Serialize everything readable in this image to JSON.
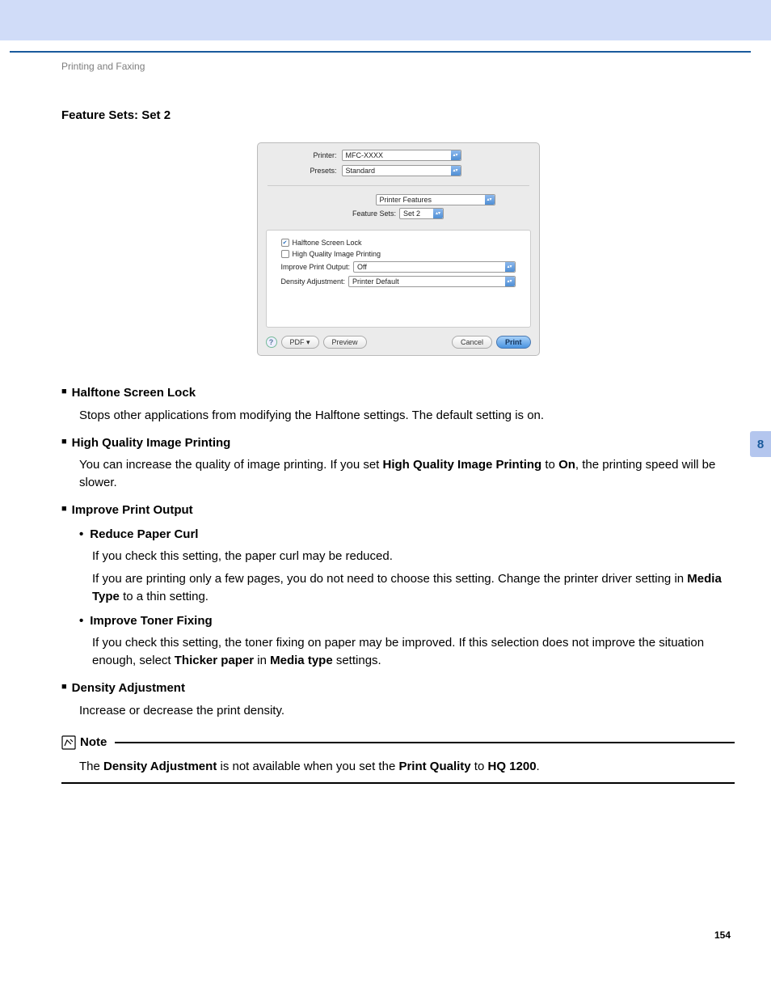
{
  "breadcrumb": "Printing and Faxing",
  "section_heading": "Feature Sets: Set 2",
  "side_tab": "8",
  "page_number": "154",
  "dialog": {
    "printer_label": "Printer:",
    "printer_value": "MFC-XXXX",
    "presets_label": "Presets:",
    "presets_value": "Standard",
    "panel_value": "Printer Features",
    "feature_sets_label": "Feature Sets:",
    "feature_sets_value": "Set 2",
    "halftone_label": "Halftone Screen Lock",
    "highquality_label": "High Quality Image Printing",
    "improve_label": "Improve Print Output:",
    "improve_value": "Off",
    "density_label": "Density Adjustment:",
    "density_value": "Printer Default",
    "pdf_btn": "PDF ▾",
    "preview_btn": "Preview",
    "cancel_btn": "Cancel",
    "print_btn": "Print"
  },
  "items": {
    "halftone": {
      "title": "Halftone Screen Lock",
      "desc": "Stops other applications from modifying the Halftone settings. The default setting is on."
    },
    "hq": {
      "title": "High Quality Image Printing",
      "desc_pre": "You can increase the quality of image printing. If you set ",
      "desc_b1": "High Quality Image Printing",
      "desc_mid": " to ",
      "desc_b2": "On",
      "desc_post": ", the printing speed will be slower."
    },
    "improve": {
      "title": "Improve Print Output",
      "reduce": {
        "title": "Reduce Paper Curl",
        "p1": "If you check this setting, the paper curl may be reduced.",
        "p2_pre": "If you are printing only a few pages, you do not need to choose this setting. Change the printer driver setting in ",
        "p2_b": "Media Type",
        "p2_post": " to a thin setting."
      },
      "toner": {
        "title": "Improve Toner Fixing",
        "p_pre": "If you check this setting, the toner fixing on paper may be improved. If this selection does not improve the situation enough, select ",
        "p_b1": "Thicker paper",
        "p_mid": " in ",
        "p_b2": "Media type",
        "p_post": " settings."
      }
    },
    "density": {
      "title": "Density Adjustment",
      "desc": "Increase or decrease the print density."
    }
  },
  "note": {
    "label": "Note",
    "text_pre": "The ",
    "text_b1": "Density Adjustment",
    "text_mid": " is not available when you set the ",
    "text_b2": "Print Quality",
    "text_mid2": " to ",
    "text_b3": "HQ 1200",
    "text_post": "."
  }
}
